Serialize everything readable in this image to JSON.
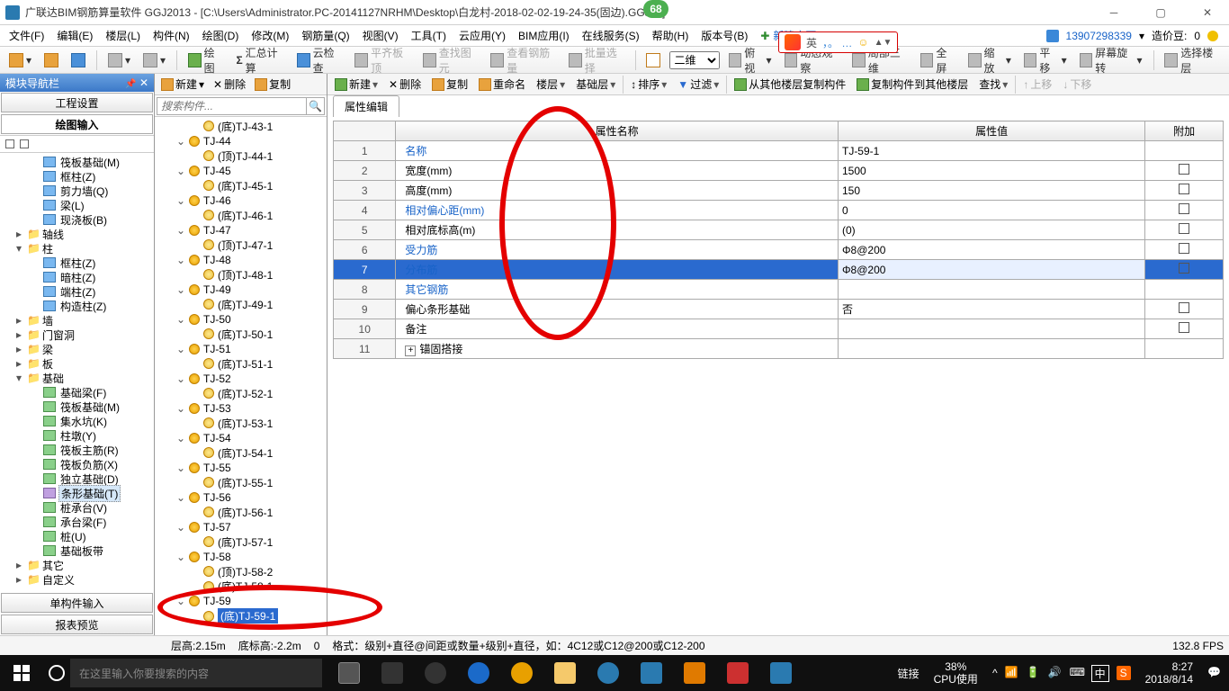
{
  "title": "广联达BIM钢筋算量软件 GGJ2013 - [C:\\Users\\Administrator.PC-20141127NRHM\\Desktop\\白龙村-2018-02-02-19-24-35(固边).GGJ12]",
  "sg_badge": "68",
  "sg_text": "英",
  "sg_hint": "，。 …",
  "menu": [
    "文件(F)",
    "编辑(E)",
    "楼层(L)",
    "构件(N)",
    "绘图(D)",
    "修改(M)",
    "钢筋量(Q)",
    "视图(V)",
    "工具(T)",
    "云应用(Y)",
    "BIM应用(I)",
    "在线服务(S)",
    "帮助(H)",
    "版本号(B)"
  ],
  "menu_right": {
    "new_change": "新建变更",
    "user": "13907298339",
    "credit_label": "造价豆:",
    "credit_value": "0"
  },
  "tb1": {
    "draw": "绘图",
    "sum": "汇总计算",
    "cloud": "云检查",
    "slab": "平齐板顶",
    "findimg": "查找图元",
    "viewsteel": "查看钢筋量",
    "batch": "批量选择",
    "dim_label": "二维",
    "rot": "俯视",
    "dyn": "动态观察",
    "local3d": "局部三维",
    "full": "全屏",
    "zoom": "缩放",
    "pan": "平移",
    "scrrot": "屏幕旋转",
    "selfloor": "选择楼层"
  },
  "dock": {
    "title": "模块导航栏",
    "tabs": [
      "工程设置",
      "绘图输入"
    ],
    "bottom": [
      "单构件输入",
      "报表预览"
    ]
  },
  "nav": [
    {
      "d": 2,
      "ic": "blue",
      "lbl": "筏板基础(M)"
    },
    {
      "d": 2,
      "ic": "blue",
      "lbl": "框柱(Z)"
    },
    {
      "d": 2,
      "ic": "blue",
      "lbl": "剪力墙(Q)"
    },
    {
      "d": 2,
      "ic": "blue",
      "lbl": "梁(L)"
    },
    {
      "d": 2,
      "ic": "blue",
      "lbl": "现浇板(B)"
    },
    {
      "d": 1,
      "arr": "▸",
      "ic": "",
      "lbl": "轴线"
    },
    {
      "d": 1,
      "arr": "▾",
      "ic": "",
      "lbl": "柱"
    },
    {
      "d": 2,
      "ic": "blue",
      "lbl": "框柱(Z)"
    },
    {
      "d": 2,
      "ic": "blue",
      "lbl": "暗柱(Z)"
    },
    {
      "d": 2,
      "ic": "blue",
      "lbl": "端柱(Z)"
    },
    {
      "d": 2,
      "ic": "blue",
      "lbl": "构造柱(Z)"
    },
    {
      "d": 1,
      "arr": "▸",
      "ic": "",
      "lbl": "墙"
    },
    {
      "d": 1,
      "arr": "▸",
      "ic": "",
      "lbl": "门窗洞"
    },
    {
      "d": 1,
      "arr": "▸",
      "ic": "",
      "lbl": "梁"
    },
    {
      "d": 1,
      "arr": "▸",
      "ic": "",
      "lbl": "板"
    },
    {
      "d": 1,
      "arr": "▾",
      "ic": "",
      "lbl": "基础"
    },
    {
      "d": 2,
      "ic": "grn",
      "lbl": "基础梁(F)"
    },
    {
      "d": 2,
      "ic": "grn",
      "lbl": "筏板基础(M)"
    },
    {
      "d": 2,
      "ic": "grn",
      "lbl": "集水坑(K)"
    },
    {
      "d": 2,
      "ic": "grn",
      "lbl": "柱墩(Y)"
    },
    {
      "d": 2,
      "ic": "grn",
      "lbl": "筏板主筋(R)"
    },
    {
      "d": 2,
      "ic": "grn",
      "lbl": "筏板负筋(X)"
    },
    {
      "d": 2,
      "ic": "grn",
      "lbl": "独立基础(D)"
    },
    {
      "d": 2,
      "ic": "prp",
      "lbl": "条形基础(T)",
      "selected": true
    },
    {
      "d": 2,
      "ic": "grn",
      "lbl": "桩承台(V)"
    },
    {
      "d": 2,
      "ic": "grn",
      "lbl": "承台梁(F)"
    },
    {
      "d": 2,
      "ic": "grn",
      "lbl": "桩(U)"
    },
    {
      "d": 2,
      "ic": "grn",
      "lbl": "基础板带"
    },
    {
      "d": 1,
      "arr": "▸",
      "ic": "",
      "lbl": "其它"
    },
    {
      "d": 1,
      "arr": "▸",
      "ic": "",
      "lbl": "自定义"
    }
  ],
  "mid_tb": {
    "new": "新建",
    "del": "删除",
    "copy": "复制",
    "rename": "重命名",
    "floor": "楼层",
    "base": "基础层"
  },
  "mid_search_ph": "搜索构件...",
  "mid_tree": [
    {
      "type": "leaf",
      "lbl": "(底)TJ-43-1"
    },
    {
      "type": "group",
      "lbl": "TJ-44"
    },
    {
      "type": "leaf",
      "lbl": "(顶)TJ-44-1"
    },
    {
      "type": "group",
      "lbl": "TJ-45"
    },
    {
      "type": "leaf",
      "lbl": "(底)TJ-45-1"
    },
    {
      "type": "group",
      "lbl": "TJ-46"
    },
    {
      "type": "leaf",
      "lbl": "(底)TJ-46-1"
    },
    {
      "type": "group",
      "lbl": "TJ-47"
    },
    {
      "type": "leaf",
      "lbl": "(顶)TJ-47-1"
    },
    {
      "type": "group",
      "lbl": "TJ-48"
    },
    {
      "type": "leaf",
      "lbl": "(顶)TJ-48-1"
    },
    {
      "type": "group",
      "lbl": "TJ-49"
    },
    {
      "type": "leaf",
      "lbl": "(底)TJ-49-1"
    },
    {
      "type": "group",
      "lbl": "TJ-50"
    },
    {
      "type": "leaf",
      "lbl": "(底)TJ-50-1"
    },
    {
      "type": "group",
      "lbl": "TJ-51"
    },
    {
      "type": "leaf",
      "lbl": "(底)TJ-51-1"
    },
    {
      "type": "group",
      "lbl": "TJ-52"
    },
    {
      "type": "leaf",
      "lbl": "(底)TJ-52-1"
    },
    {
      "type": "group",
      "lbl": "TJ-53"
    },
    {
      "type": "leaf",
      "lbl": "(底)TJ-53-1"
    },
    {
      "type": "group",
      "lbl": "TJ-54"
    },
    {
      "type": "leaf",
      "lbl": "(底)TJ-54-1"
    },
    {
      "type": "group",
      "lbl": "TJ-55"
    },
    {
      "type": "leaf",
      "lbl": "(底)TJ-55-1"
    },
    {
      "type": "group",
      "lbl": "TJ-56"
    },
    {
      "type": "leaf",
      "lbl": "(底)TJ-56-1"
    },
    {
      "type": "group",
      "lbl": "TJ-57"
    },
    {
      "type": "leaf",
      "lbl": "(底)TJ-57-1"
    },
    {
      "type": "group",
      "lbl": "TJ-58"
    },
    {
      "type": "leaf",
      "lbl": "(顶)TJ-58-2"
    },
    {
      "type": "leaf",
      "lbl": "(底)TJ-58-1"
    },
    {
      "type": "group",
      "lbl": "TJ-59"
    },
    {
      "type": "leaf",
      "lbl": "(底)TJ-59-1",
      "selected": true
    }
  ],
  "right_tb": {
    "new": "新建",
    "del": "删除",
    "copy": "复制",
    "rename": "重命名",
    "floor": "楼层",
    "base": "基础层",
    "sort": "排序",
    "filter": "过滤",
    "copyfrom": "从其他楼层复制构件",
    "copyto": "复制构件到其他楼层",
    "find": "查找",
    "up": "上移",
    "down": "下移"
  },
  "prop_tab": "属性编辑",
  "prop_headers": {
    "name": "属性名称",
    "value": "属性值",
    "extra": "附加"
  },
  "props": [
    {
      "n": "1",
      "name": "名称",
      "val": "TJ-59-1",
      "link": true,
      "chk": false
    },
    {
      "n": "2",
      "name": "宽度(mm)",
      "val": "1500",
      "chk": true
    },
    {
      "n": "3",
      "name": "高度(mm)",
      "val": "150",
      "chk": true
    },
    {
      "n": "4",
      "name": "相对偏心距(mm)",
      "val": "0",
      "link": true,
      "chk": true
    },
    {
      "n": "5",
      "name": "相对底标高(m)",
      "val": "(0)",
      "chk": true
    },
    {
      "n": "6",
      "name": "受力筋",
      "val": "Φ8@200",
      "link": true,
      "chk": true
    },
    {
      "n": "7",
      "name": "分布筋",
      "val": "Φ8@200",
      "link": true,
      "chk": true,
      "selected": true,
      "editing": true
    },
    {
      "n": "8",
      "name": "其它钢筋",
      "val": "",
      "link": true,
      "chk": false
    },
    {
      "n": "9",
      "name": "偏心条形基础",
      "val": "否",
      "chk": true
    },
    {
      "n": "10",
      "name": "备注",
      "val": "",
      "chk": true
    },
    {
      "n": "11",
      "name": "锚固搭接",
      "val": "",
      "chk": false,
      "expandable": true
    }
  ],
  "status": {
    "floor_h": "层高:2.15m",
    "bottom_h": "底标高:-2.2m",
    "zero": "0",
    "format": "格式：级别+直径@间距或数量+级别+直径，如：4C12或C12@200或C12-200",
    "fps": "132.8 FPS"
  },
  "taskbar": {
    "search_ph": "在这里输入你要搜索的内容",
    "link": "链接",
    "cpu_pct": "38%",
    "cpu_lbl": "CPU使用",
    "time": "8:27",
    "date": "2018/8/14",
    "ime1": "中",
    "ime2": "S"
  }
}
